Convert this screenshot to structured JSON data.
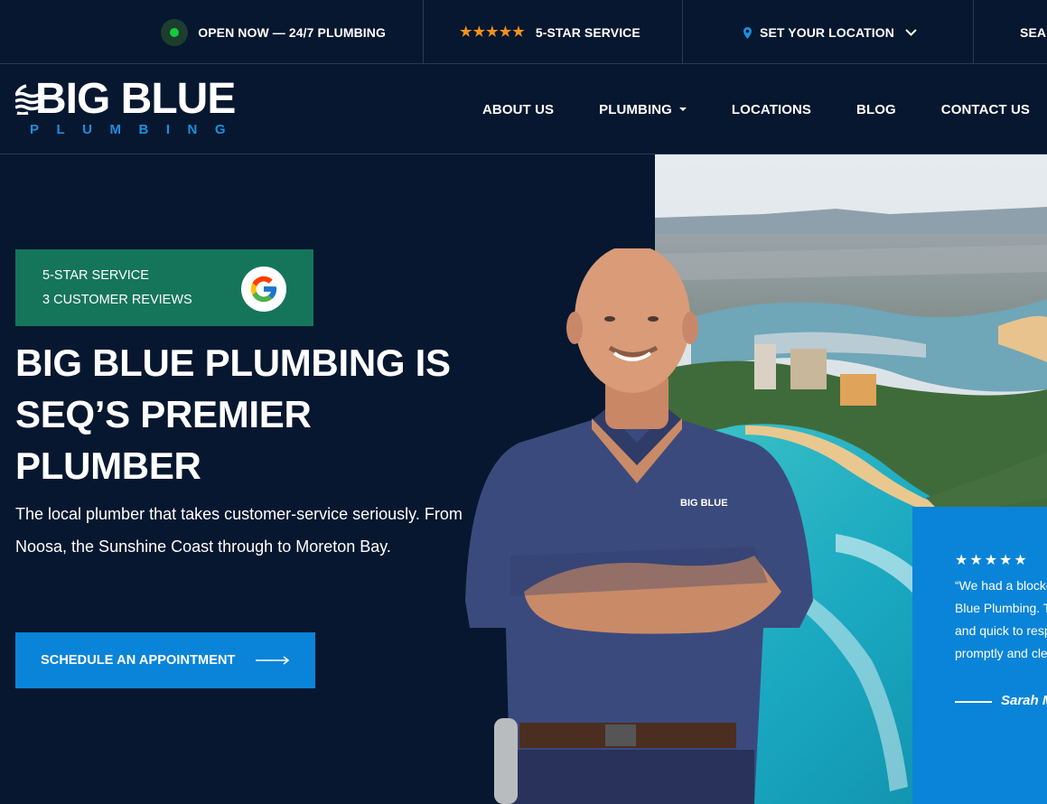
{
  "topbar": {
    "open_label": "OPEN NOW — 24/7 PLUMBING",
    "stars_label": "5-STAR SERVICE",
    "location_label": "SET YOUR LOCATION",
    "search_label": "SEARCH"
  },
  "logo": {
    "main": "BIG BLUE",
    "sub": "PLUMBING"
  },
  "nav": {
    "items": [
      {
        "label": "ABOUT US"
      },
      {
        "label": "PLUMBING"
      },
      {
        "label": "LOCATIONS"
      },
      {
        "label": "BLOG"
      },
      {
        "label": "CONTACT US"
      }
    ]
  },
  "hero": {
    "badge_line1": "5-STAR SERVICE",
    "badge_line2": "3 CUSTOMER REVIEWS",
    "title": "BIG BLUE PLUMBING IS SEQ’S PREMIER PLUMBER",
    "description": "The local plumber that takes customer-service seriously. From Noosa, the Sunshine Coast through to Moreton Bay.",
    "cta_label": "SCHEDULE AN APPOINTMENT",
    "shirt_logo": "BIG BLUE"
  },
  "testimonial": {
    "stars": 5,
    "lines": [
      "“We had a blocked drain and called Big",
      "Blue Plumbing. They were very professional",
      "and quick to respond. The job was done",
      "promptly and cleanly."
    ],
    "author": "Sarah M."
  },
  "colors": {
    "background": "#06172f",
    "accent_blue": "#0a84d8",
    "badge_green": "#15755a",
    "star_orange": "#f5921e",
    "open_green": "#18c93a"
  }
}
